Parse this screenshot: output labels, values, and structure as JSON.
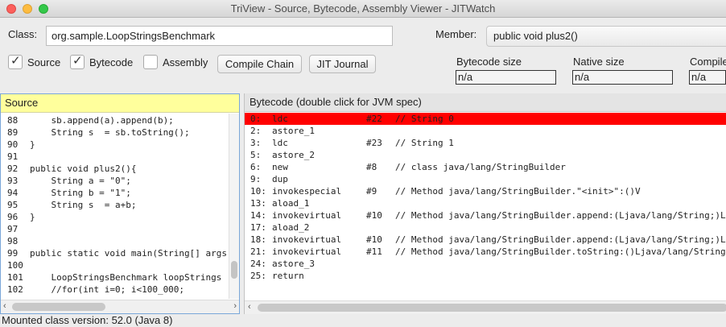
{
  "window": {
    "title": "TriView - Source, Bytecode, Assembly Viewer - JITWatch"
  },
  "class_field": {
    "label": "Class:",
    "value": "org.sample.LoopStringsBenchmark"
  },
  "member_field": {
    "label": "Member:",
    "value": "public void plus2()"
  },
  "toggles": [
    {
      "label": "Source",
      "checked": true
    },
    {
      "label": "Bytecode",
      "checked": true
    },
    {
      "label": "Assembly",
      "checked": false
    }
  ],
  "buttons": {
    "compile_chain": "Compile Chain",
    "jit_journal": "JIT Journal"
  },
  "stats": [
    {
      "label": "Bytecode size",
      "value": "n/a"
    },
    {
      "label": "Native size",
      "value": "n/a"
    },
    {
      "label": "Compile",
      "value": "n/a"
    }
  ],
  "source_pane": {
    "header": "Source",
    "lines": [
      {
        "num": "88",
        "text": "    sb.append(a).append(b);"
      },
      {
        "num": "89",
        "text": "    String s  = sb.toString();"
      },
      {
        "num": "90",
        "text": "}"
      },
      {
        "num": "91",
        "text": ""
      },
      {
        "num": "92",
        "text": "public void plus2(){"
      },
      {
        "num": "93",
        "text": "    String a = \"0\";"
      },
      {
        "num": "94",
        "text": "    String b = \"1\";"
      },
      {
        "num": "95",
        "text": "    String s  = a+b;"
      },
      {
        "num": "96",
        "text": "}"
      },
      {
        "num": "97",
        "text": ""
      },
      {
        "num": "98",
        "text": ""
      },
      {
        "num": "99",
        "text": "public static void main(String[] args) {"
      },
      {
        "num": "100",
        "text": ""
      },
      {
        "num": "101",
        "text": "    LoopStringsBenchmark loopStrings"
      },
      {
        "num": "102",
        "text": "    //for(int i=0; i<100_000;"
      }
    ]
  },
  "bytecode_pane": {
    "header": "Bytecode (double click for JVM spec)",
    "lines": [
      {
        "offset": "0:",
        "op": "ldc",
        "ref": "#22",
        "comment": "// String 0",
        "highlighted": true
      },
      {
        "offset": "2:",
        "op": "astore_1",
        "ref": "",
        "comment": ""
      },
      {
        "offset": "3:",
        "op": "ldc",
        "ref": "#23",
        "comment": "// String 1"
      },
      {
        "offset": "5:",
        "op": "astore_2",
        "ref": "",
        "comment": ""
      },
      {
        "offset": "6:",
        "op": "new",
        "ref": "#8",
        "comment": "// class java/lang/StringBuilder"
      },
      {
        "offset": "9:",
        "op": "dup",
        "ref": "",
        "comment": ""
      },
      {
        "offset": "10:",
        "op": "invokespecial",
        "ref": "#9",
        "comment": "// Method java/lang/StringBuilder.\"<init>\":()V"
      },
      {
        "offset": "13:",
        "op": "aload_1",
        "ref": "",
        "comment": ""
      },
      {
        "offset": "14:",
        "op": "invokevirtual",
        "ref": "#10",
        "comment": "// Method java/lang/StringBuilder.append:(Ljava/lang/String;)Ljava/lang/StringBuilder;"
      },
      {
        "offset": "17:",
        "op": "aload_2",
        "ref": "",
        "comment": ""
      },
      {
        "offset": "18:",
        "op": "invokevirtual",
        "ref": "#10",
        "comment": "// Method java/lang/StringBuilder.append:(Ljava/lang/String;)Ljava/lang/StringBuilder;"
      },
      {
        "offset": "21:",
        "op": "invokevirtual",
        "ref": "#11",
        "comment": "// Method java/lang/StringBuilder.toString:()Ljava/lang/String;"
      },
      {
        "offset": "24:",
        "op": "astore_3",
        "ref": "",
        "comment": ""
      },
      {
        "offset": "25:",
        "op": "return",
        "ref": "",
        "comment": ""
      }
    ]
  },
  "status": {
    "text": "Mounted class version: 52.0 (Java 8)"
  },
  "colors": {
    "highlight": "#ff0000",
    "source_header": "#ffff9c",
    "pane_border": "#7aa7d9"
  }
}
